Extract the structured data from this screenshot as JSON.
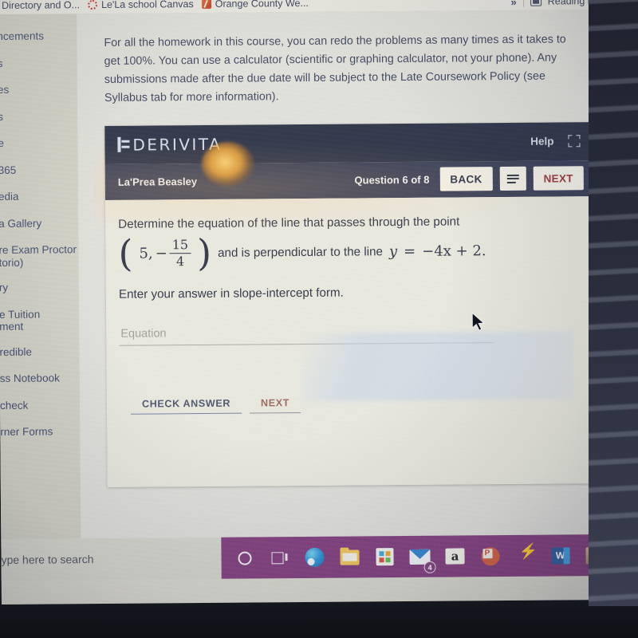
{
  "browser": {
    "bookmarks": [
      {
        "label": "Directory and O...",
        "icon": "none"
      },
      {
        "label": "Le'La school Canvas",
        "icon": "canvas-icon"
      },
      {
        "label": "Orange County We...",
        "icon": "orange-square-icon"
      }
    ],
    "overflow_label": "»",
    "reading_list_label": "Reading list"
  },
  "sidebar": {
    "items": [
      {
        "label": "ncements"
      },
      {
        "label": "s"
      },
      {
        "label": "es"
      },
      {
        "label": "s"
      },
      {
        "label": "e"
      },
      {
        "label": "365"
      },
      {
        "label": "edia"
      },
      {
        "label": "a Gallery"
      },
      {
        "label": "re Exam Proctor\n torio)"
      },
      {
        "label": "ry"
      },
      {
        "label": "e Tuition\nment"
      },
      {
        "label": "redible"
      },
      {
        "label": "ss Notebook"
      },
      {
        "label": "check"
      },
      {
        "label": "rner Forms"
      }
    ]
  },
  "main": {
    "intro_paragraph": "For all the homework in this course, you can redo the problems as many times as it takes to get 100%. You can use a calculator (scientific or graphing calculator, not your phone). Any submissions made after the due date will be subject to the Late Coursework Policy (see Syllabus tab for more information)."
  },
  "derivita": {
    "logo_text": "DERIVITA",
    "help_label": "Help",
    "fullscreen_icon": "fullscreen-icon",
    "student_name": "La'Prea Beasley",
    "question_counter": "Question 6 of 8",
    "back_label": "BACK",
    "menu_icon": "hamburger-menu-icon",
    "next_label": "NEXT",
    "question": {
      "line1": "Determine the equation of the line that passes through the point",
      "point_x": "5,",
      "point_sign": "−",
      "fraction_numerator": "15",
      "fraction_denominator": "4",
      "line2_mid": "and is perpendicular to the line",
      "eq_y": "y",
      "eq_equals": "=",
      "eq_rhs": "−4x + 2.",
      "prompt": "Enter your answer in slope-intercept form."
    },
    "answer": {
      "placeholder": "Equation",
      "value": ""
    },
    "check_answer_label": "CHECK ANSWER",
    "next_answer_label": "NEXT"
  },
  "taskbar": {
    "search_placeholder": "ype here to search",
    "icons": [
      {
        "name": "cortana-icon"
      },
      {
        "name": "task-view-icon"
      },
      {
        "name": "edge-browser-icon"
      },
      {
        "name": "file-explorer-icon"
      },
      {
        "name": "microsoft-store-icon"
      },
      {
        "name": "mail-icon",
        "badge": "4"
      },
      {
        "name": "amazon-icon",
        "label": "a"
      },
      {
        "name": "powerpoint-icon",
        "label": "P"
      },
      {
        "name": "lightning-icon"
      },
      {
        "name": "word-icon",
        "label": "W"
      },
      {
        "name": "photo-thumbnail-icon"
      }
    ]
  },
  "colors": {
    "derivita_header": "#242b40",
    "derivita_subheader": "#2f3650",
    "next_button_text": "#8d2f35",
    "taskbar": "#7b3a78",
    "sidebar_link": "#3a4468"
  }
}
